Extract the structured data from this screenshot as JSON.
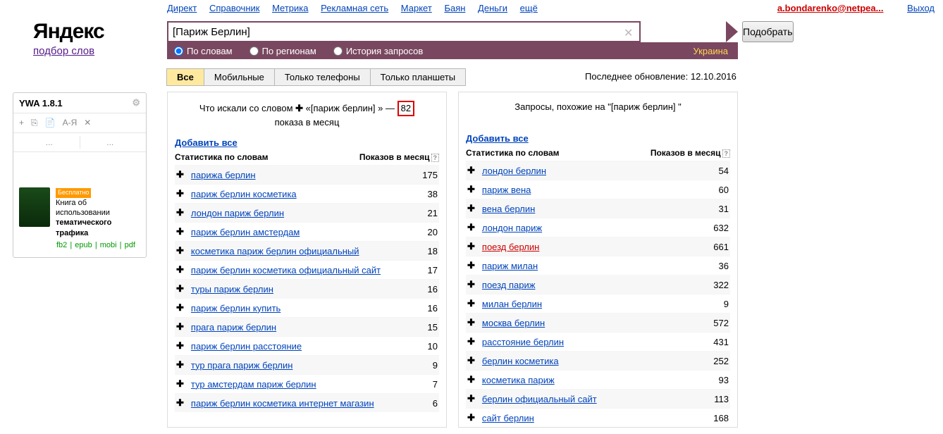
{
  "topnav": [
    "Директ",
    "Справочник",
    "Метрика",
    "Рекламная сеть",
    "Маркет",
    "Баян",
    "Деньги"
  ],
  "topnav_more": "ещё",
  "user": {
    "name": "a.bondarenko@netpea...",
    "logout": "Выход"
  },
  "logo": {
    "brand": "Яндекс",
    "sub": "подбор слов"
  },
  "search": {
    "value": "[Париж Берлин]",
    "submit": "Подобрать"
  },
  "radios": {
    "r1": "По словам",
    "r2": "По регионам",
    "r3": "История запросов"
  },
  "region": "Украина",
  "device_tabs": [
    "Все",
    "Мобильные",
    "Только телефоны",
    "Только планшеты"
  ],
  "last_update": "Последнее обновление: 12.10.2016",
  "left_col": {
    "title_pre": "Что искали со словом ",
    "title_bold": "«[париж берлин] »",
    "title_dash": " — ",
    "title_num": "82",
    "title_post": "показа в месяц",
    "add_all": "Добавить все",
    "head_l": "Статистика по словам",
    "head_r": "Показов в месяц",
    "rows": [
      {
        "t": "парижа берлин",
        "n": "175"
      },
      {
        "t": "париж берлин косметика",
        "n": "38"
      },
      {
        "t": "лондон париж берлин",
        "n": "21"
      },
      {
        "t": "париж берлин амстердам",
        "n": "20"
      },
      {
        "t": "косметика париж берлин официальный",
        "n": "18"
      },
      {
        "t": "париж берлин косметика официальный сайт",
        "n": "17"
      },
      {
        "t": "туры париж берлин",
        "n": "16"
      },
      {
        "t": "париж берлин купить",
        "n": "16"
      },
      {
        "t": "прага париж берлин",
        "n": "15"
      },
      {
        "t": "париж берлин расстояние",
        "n": "10"
      },
      {
        "t": "тур прага париж берлин",
        "n": "9"
      },
      {
        "t": "тур амстердам париж берлин",
        "n": "7"
      },
      {
        "t": "париж берлин косметика интернет магазин",
        "n": "6"
      }
    ]
  },
  "right_col": {
    "title": "Запросы, похожие на \"[париж берлин] \"",
    "add_all": "Добавить все",
    "head_l": "Статистика по словам",
    "head_r": "Показов в месяц",
    "rows": [
      {
        "t": "лондон берлин",
        "n": "54"
      },
      {
        "t": "париж вена",
        "n": "60"
      },
      {
        "t": "вена берлин",
        "n": "31"
      },
      {
        "t": "лондон париж",
        "n": "632"
      },
      {
        "t": "поезд берлин",
        "n": "661",
        "red": true
      },
      {
        "t": "париж милан",
        "n": "36"
      },
      {
        "t": "поезд париж",
        "n": "322"
      },
      {
        "t": "милан берлин",
        "n": "9"
      },
      {
        "t": "москва берлин",
        "n": "572"
      },
      {
        "t": "расстояние берлин",
        "n": "431"
      },
      {
        "t": "берлин косметика",
        "n": "252"
      },
      {
        "t": "косметика париж",
        "n": "93"
      },
      {
        "t": "берлин официальный сайт",
        "n": "113"
      },
      {
        "t": "сайт берлин",
        "n": "168"
      }
    ]
  },
  "sidebar": {
    "title": "YWA 1.8.1",
    "dots": "...",
    "book": {
      "badge": "Бесплатно",
      "line1": "Книга об использовании",
      "line2": "тематического",
      "line3": "трафика",
      "l1": "fb2",
      "l2": "epub",
      "l3": "mobi",
      "l4": "pdf"
    }
  }
}
